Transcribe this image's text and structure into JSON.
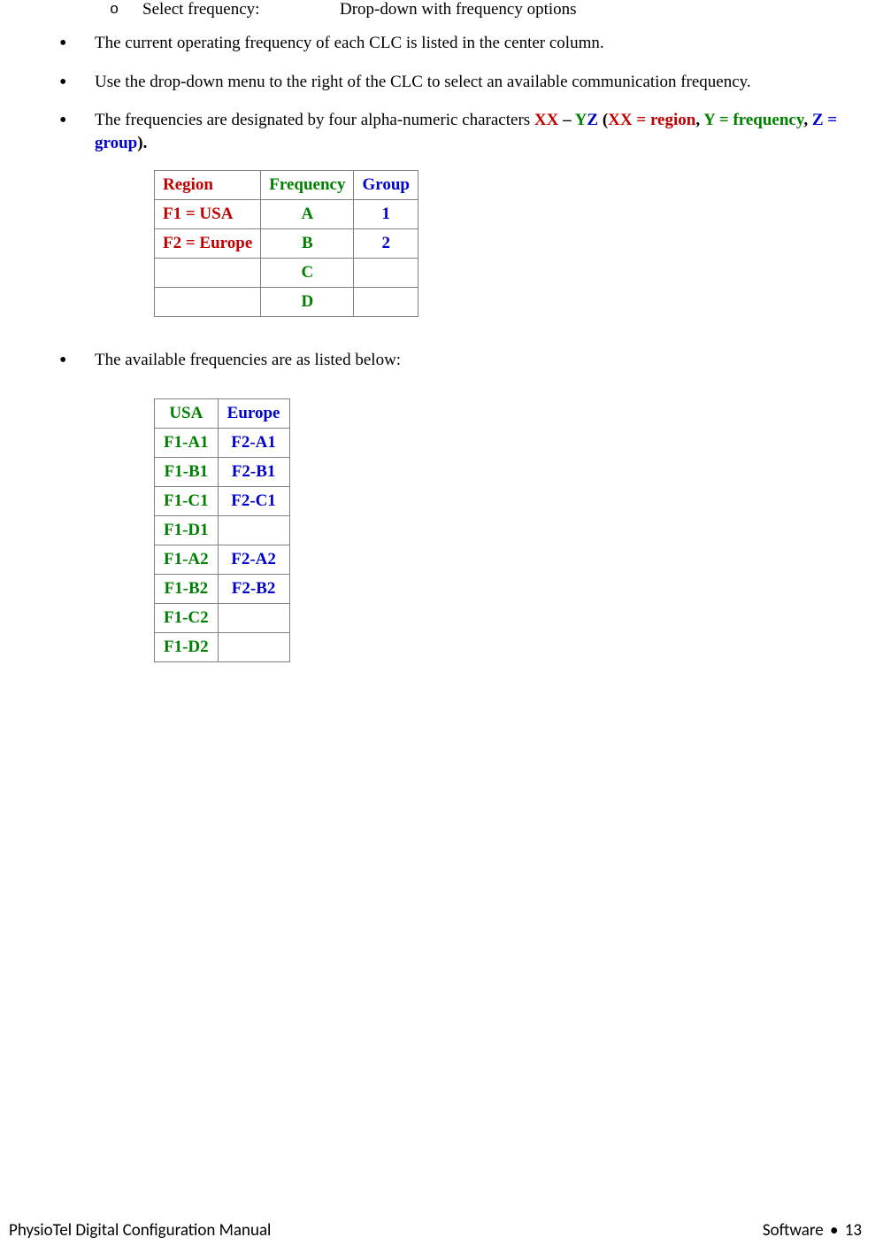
{
  "subline": {
    "marker": "o",
    "label": "Select frequency:",
    "desc": "Drop-down with frequency options"
  },
  "bullets": {
    "b1": "The current operating frequency of each CLC is listed in the center column.",
    "b2": "Use the drop-down menu to the right of the CLC to select an available communication frequency.",
    "b3_prefix": "The frequencies are designated by four alpha-numeric characters ",
    "b3_xx_yz_xx": "XX",
    "b3_dash": " – ",
    "b3_y": "Y",
    "b3_z": "Z",
    "b3_space_paren": " (",
    "b3_xx_region": "XX = region",
    "b3_comma_space": ", ",
    "b3_y_freq": "Y = frequency",
    "b3_z_group": "Z = group",
    "b3_paren_close": ")",
    "b3_period": ".",
    "b4": "The available frequencies are as listed below:"
  },
  "table1": {
    "headers": {
      "region": "Region",
      "frequency": "Frequency",
      "group": "Group"
    },
    "rows": [
      {
        "region": "F1 = USA",
        "frequency": "A",
        "group": "1"
      },
      {
        "region": "F2 = Europe",
        "frequency": "B",
        "group": "2"
      },
      {
        "region": "",
        "frequency": "C",
        "group": ""
      },
      {
        "region": "",
        "frequency": "D",
        "group": ""
      }
    ]
  },
  "table2": {
    "headers": {
      "usa": "USA",
      "europe": "Europe"
    },
    "rows": [
      {
        "usa": "F1-A1",
        "europe": "F2-A1"
      },
      {
        "usa": "F1-B1",
        "europe": "F2-B1"
      },
      {
        "usa": "F1-C1",
        "europe": "F2-C1"
      },
      {
        "usa": "F1-D1",
        "europe": ""
      },
      {
        "usa": "F1-A2",
        "europe": "F2-A2"
      },
      {
        "usa": "F1-B2",
        "europe": "F2-B2"
      },
      {
        "usa": "F1-C2",
        "europe": ""
      },
      {
        "usa": "F1-D2",
        "europe": ""
      }
    ]
  },
  "footer": {
    "left": "PhysioTel Digital Configuration Manual",
    "right_word": "Software",
    "right_page": "13"
  }
}
